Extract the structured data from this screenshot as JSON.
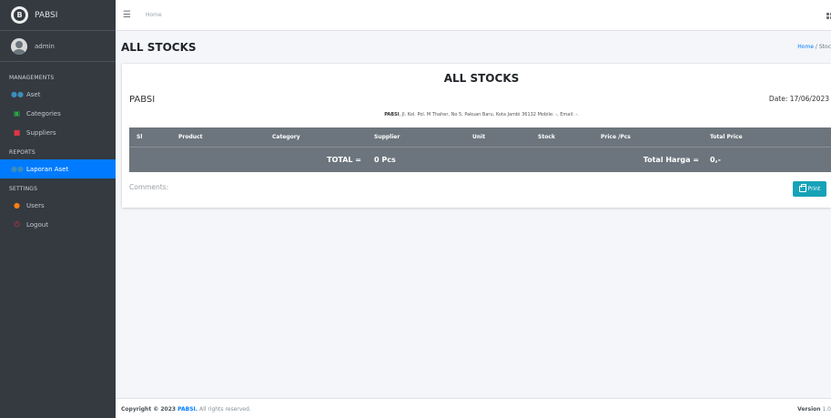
{
  "brand": {
    "name": "PABSI",
    "logo_letter": "B"
  },
  "user": {
    "name": "admin"
  },
  "sidebar": {
    "sections": [
      {
        "header": "MANAGEMENTS",
        "items": [
          {
            "label": "Aset",
            "icon": "people-icon",
            "active": false
          },
          {
            "label": "Categories",
            "icon": "sitemap-icon",
            "active": false
          },
          {
            "label": "Suppliers",
            "icon": "truck-icon",
            "active": false
          }
        ]
      },
      {
        "header": "REPORTS",
        "items": [
          {
            "label": "Laporan Aset",
            "icon": "people-icon",
            "active": true
          }
        ]
      },
      {
        "header": "SETTINGS",
        "items": [
          {
            "label": "Users",
            "icon": "users-icon",
            "active": false
          },
          {
            "label": "Logout",
            "icon": "power-icon",
            "active": false
          }
        ]
      }
    ]
  },
  "topnav": {
    "home_label": "Home"
  },
  "header": {
    "title": "ALL STOCKS",
    "breadcrumb_home": "Home",
    "breadcrumb_sep": " / ",
    "breadcrumb_current": "Stoc"
  },
  "report": {
    "title": "ALL STOCKS",
    "company": "PABSI",
    "date_label": "Date: 17/06/2023",
    "address_name": "PABSI",
    "address_rest": ", Jl. Kol. Pol. M Thaher, No 5, Pakuan Baru, Kota Jambi 36132 Mobile: -, Email: -.",
    "columns": [
      "Sl",
      "Product",
      "Category",
      "Supplier",
      "Unit",
      "Stock",
      "Price /Pcs",
      "Total Price"
    ],
    "total_label": "TOTAL =",
    "total_value": "0 Pcs",
    "total_price_label": "Total Harga =",
    "total_price_value": "0,-",
    "comments_label": "Comments:",
    "print_label": "Print"
  },
  "footer": {
    "copyright_prefix": "Copyright © 2023 ",
    "copyright_brand": "PABSI.",
    "copyright_suffix": " All rights reserved.",
    "version_label": "Version",
    "version_value": "1.0"
  },
  "colors": {
    "sidebar": "#343a40",
    "active": "#007bff",
    "table_header": "#6c757d",
    "print_button": "#17a2b8",
    "icon_blue": "#3c8dbc",
    "icon_green": "#28a745",
    "icon_red": "#dc3545",
    "icon_orange": "#fd7e14"
  }
}
